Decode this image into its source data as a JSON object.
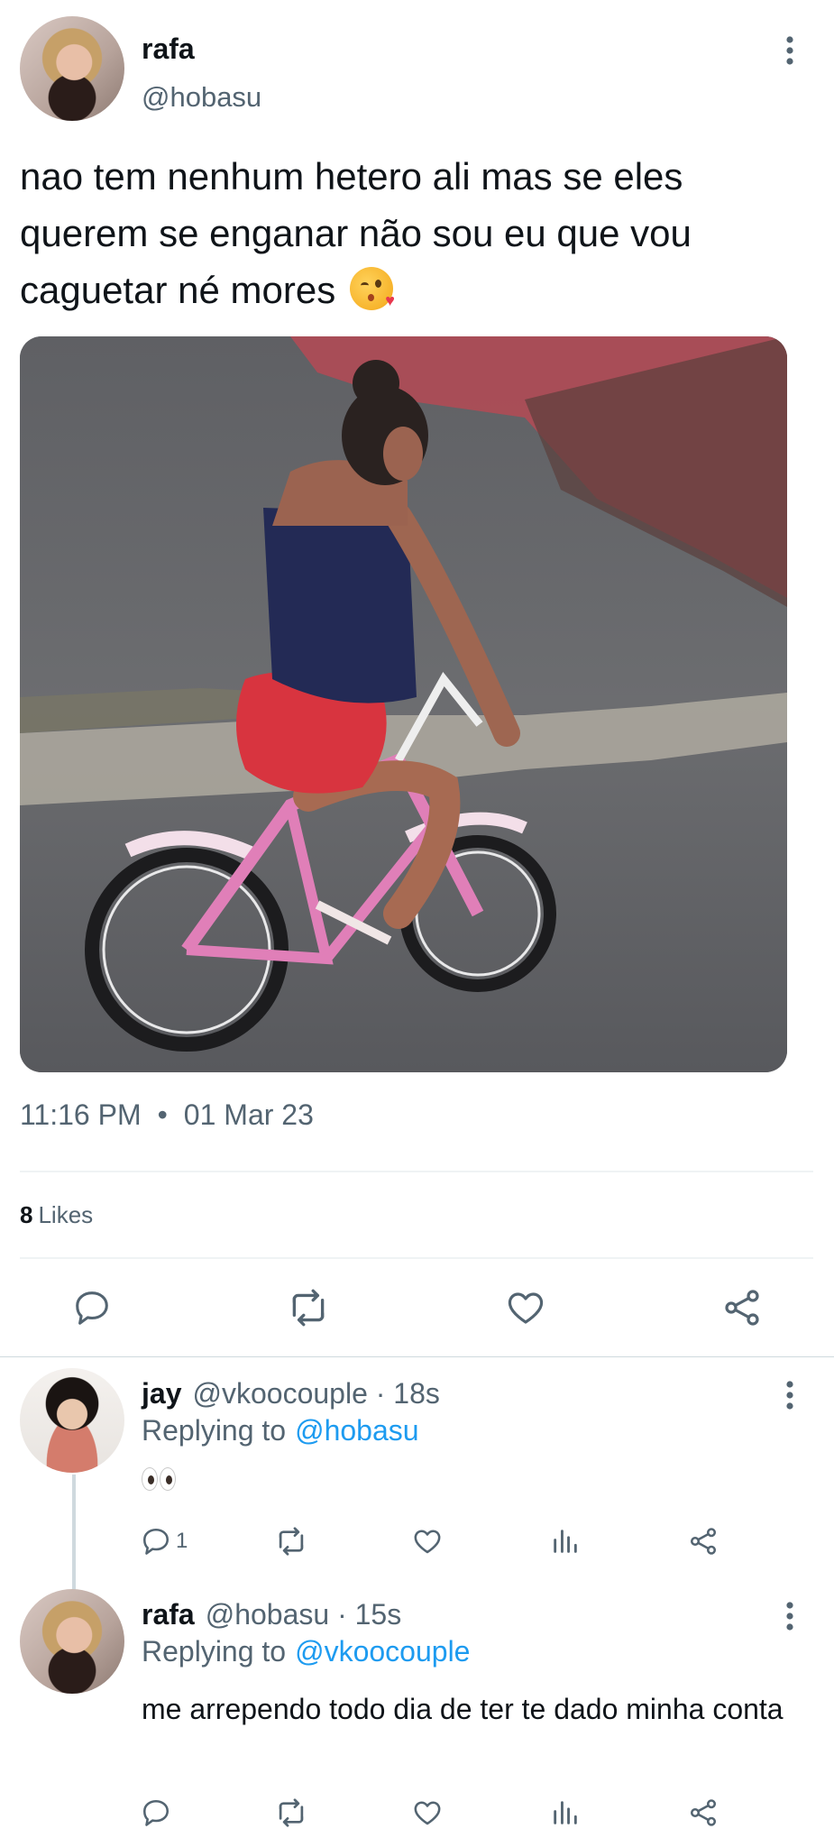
{
  "main_tweet": {
    "author_name": "rafa",
    "author_handle": "@hobasu",
    "text": "nao tem nenhum hetero ali mas se eles querem se enganar não sou eu que vou caguetar né mores",
    "emoji": "kissing-winking-face",
    "time": "11:16 PM",
    "separator": "•",
    "date": "01 Mar 23",
    "likes_count": "8",
    "likes_label": "Likes"
  },
  "replies": [
    {
      "author_name": "jay",
      "author_handle": "@vkoocouple · 18s",
      "replying_label": "Replying to",
      "replying_to": "@hobasu",
      "text_emoji": "eyes",
      "reply_count": "1"
    },
    {
      "author_name": "rafa",
      "author_handle": "@hobasu · 15s",
      "replying_label": "Replying to",
      "replying_to": "@vkoocouple",
      "text": "me arrependo todo dia de ter te dado minha conta",
      "reply_count": ""
    }
  ],
  "colors": {
    "text_primary": "#0f1419",
    "text_secondary": "#536471",
    "link": "#1d9bf0",
    "divider": "#eff3f4"
  }
}
